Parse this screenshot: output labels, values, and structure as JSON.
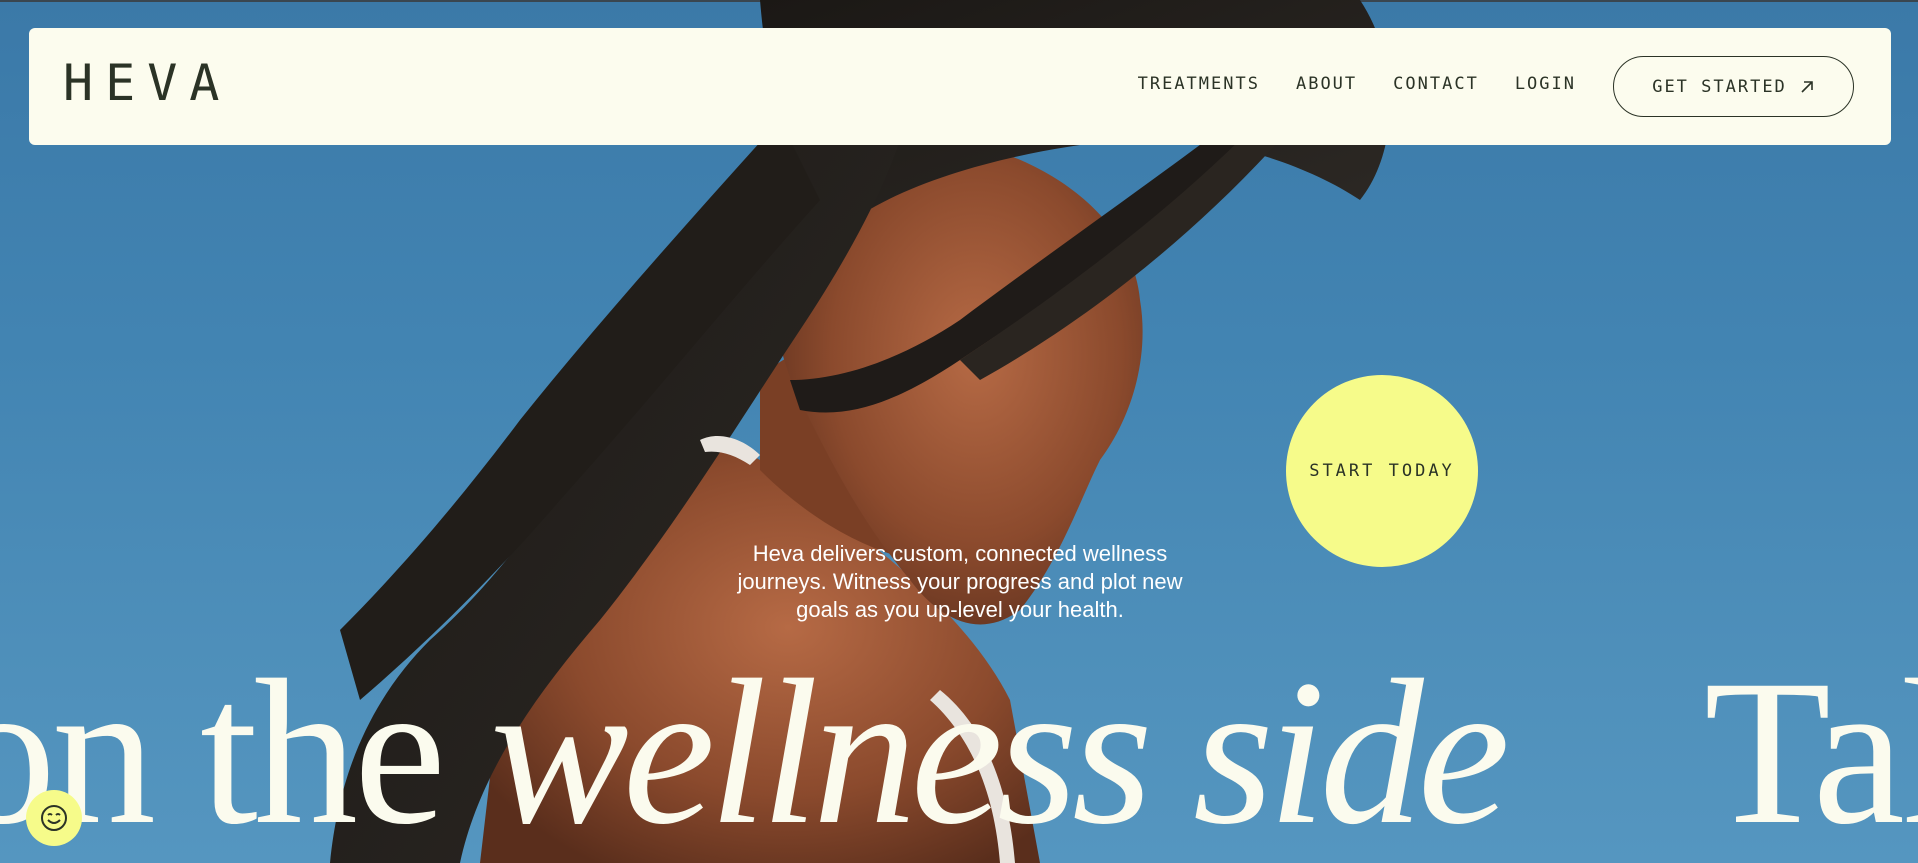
{
  "header": {
    "logo": "HEVA",
    "nav": [
      "TREATMENTS",
      "ABOUT",
      "CONTACT",
      "LOGIN"
    ],
    "cta_label": "GET STARTED"
  },
  "hero": {
    "start_label": "START TODAY",
    "tagline": "Heva delivers custom, connected wellness journeys. Witness your progress and plot new goals as you up-level your health.",
    "marquee": {
      "part1": "on the ",
      "part2_italic": "wellness side",
      "part3": "Take a w"
    }
  },
  "icons": {
    "cta": "arrow-up-right-icon",
    "a11y": "smiley-icon"
  },
  "colors": {
    "header_bg": "#fcfcee",
    "accent": "#f6fb8a",
    "sky": "#4284b2",
    "ink": "#2b3326"
  }
}
